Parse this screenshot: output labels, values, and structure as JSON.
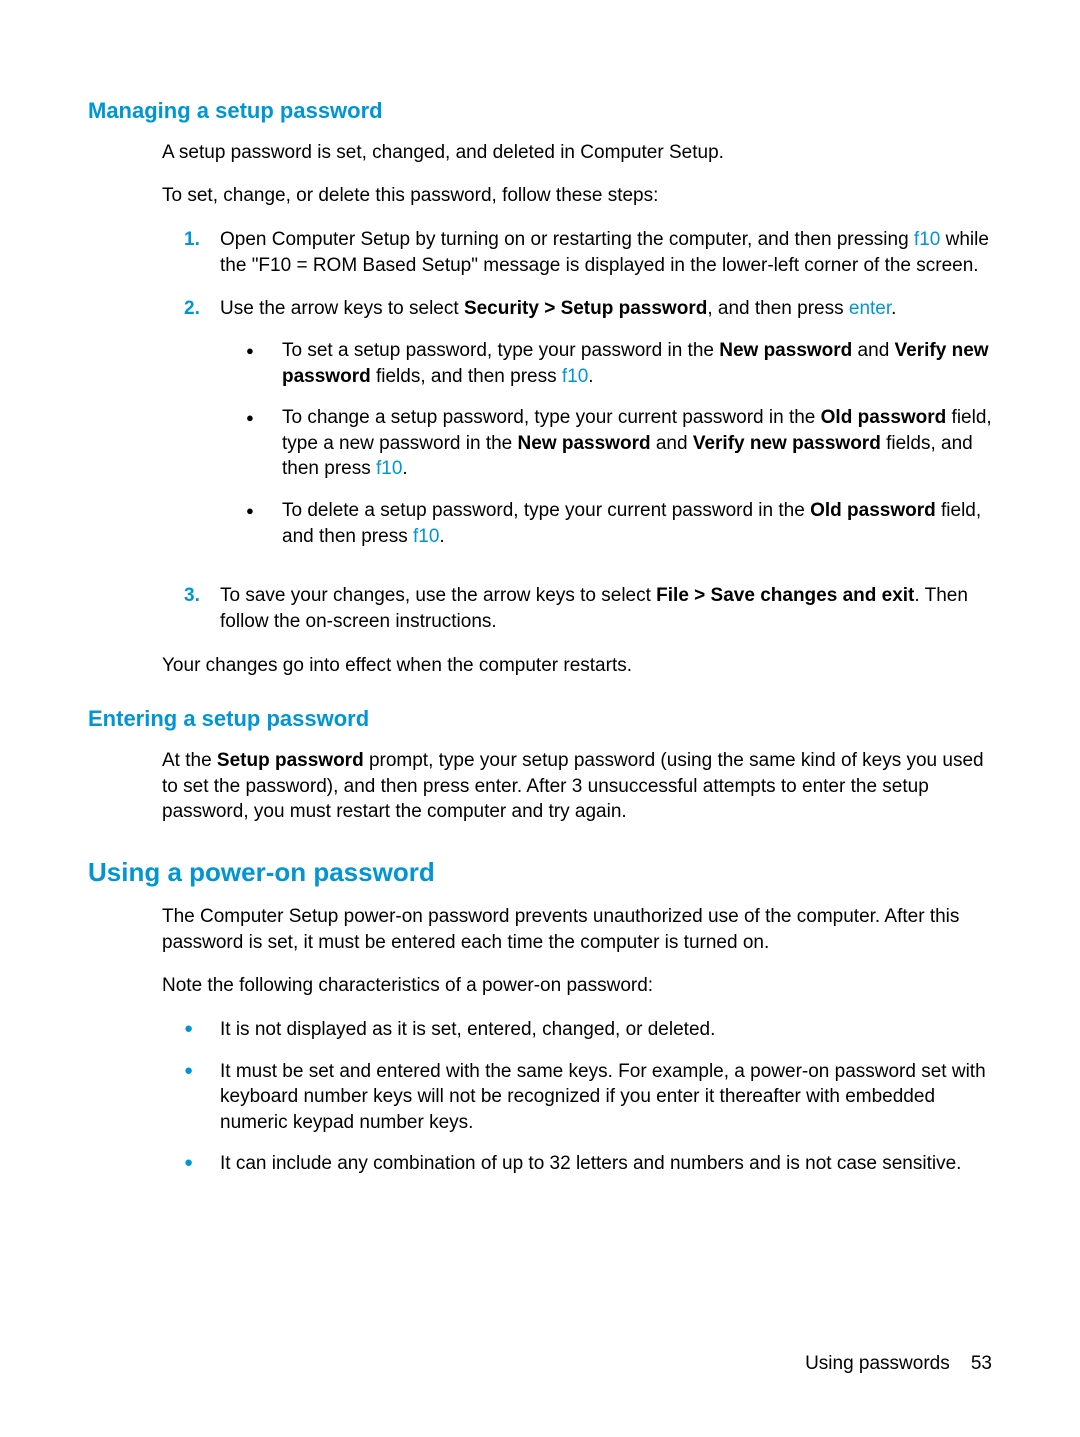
{
  "section1": {
    "heading": "Managing a setup password",
    "intro1": "A setup password is set, changed, and deleted in Computer Setup.",
    "intro2": "To set, change, or delete this password, follow these steps:",
    "step1_num": "1.",
    "step1_a": "Open Computer Setup by turning on or restarting the computer, and then pressing ",
    "step1_key": "f10",
    "step1_b": " while the \"F10 = ROM Based Setup\" message is displayed in the lower-left corner of the screen.",
    "step2_num": "2.",
    "step2_a": "Use the arrow keys to select ",
    "step2_bold": "Security > Setup password",
    "step2_b": ", and then press ",
    "step2_key": "enter",
    "step2_c": ".",
    "step2_sub1_a": "To set a setup password, type your password in the ",
    "step2_sub1_bold1": "New password",
    "step2_sub1_b": " and ",
    "step2_sub1_bold2": "Verify new password",
    "step2_sub1_c": " fields, and then press ",
    "step2_sub1_key": "f10",
    "step2_sub1_d": ".",
    "step2_sub2_a": "To change a setup password, type your current password in the ",
    "step2_sub2_bold1": "Old password",
    "step2_sub2_b": " field, type a new password in the ",
    "step2_sub2_bold2": "New password",
    "step2_sub2_c": " and ",
    "step2_sub2_bold3": "Verify new password",
    "step2_sub2_d": " fields, and then press ",
    "step2_sub2_key": "f10",
    "step2_sub2_e": ".",
    "step2_sub3_a": "To delete a setup password, type your current password in the ",
    "step2_sub3_bold1": "Old password",
    "step2_sub3_b": " field, and then press ",
    "step2_sub3_key": "f10",
    "step2_sub3_c": ".",
    "step3_num": "3.",
    "step3_a": "To save your changes, use the arrow keys to select ",
    "step3_bold": "File > Save changes and exit",
    "step3_b": ". Then follow the on-screen instructions.",
    "outro": "Your changes go into effect when the computer restarts."
  },
  "section2": {
    "heading": "Entering a setup password",
    "p_a": "At the ",
    "p_bold": "Setup password",
    "p_b": " prompt, type your setup password (using the same kind of keys you used to set the password), and then press enter. After 3 unsuccessful attempts to enter the setup password, you must restart the computer and try again."
  },
  "section3": {
    "heading": "Using a power-on password",
    "intro1": "The Computer Setup power-on password prevents unauthorized use of the computer. After this password is set, it must be entered each time the computer is turned on.",
    "intro2": "Note the following characteristics of a power-on password:",
    "b1": "It is not displayed as it is set, entered, changed, or deleted.",
    "b2": "It must be set and entered with the same keys. For example, a power-on password set with keyboard number keys will not be recognized if you enter it thereafter with embedded numeric keypad number keys.",
    "b3": "It can include any combination of up to 32 letters and numbers and is not case sensitive."
  },
  "footer": {
    "text": "Using passwords",
    "page": "53"
  }
}
